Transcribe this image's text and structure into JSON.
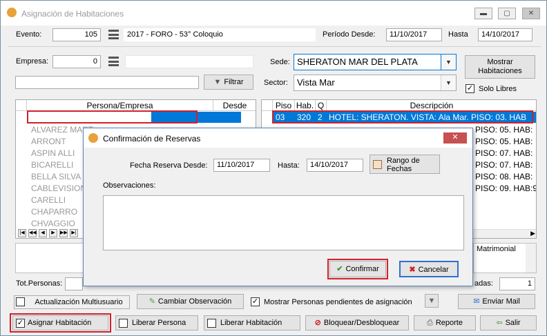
{
  "window": {
    "title": "Asignación de Habitaciones",
    "min": "▬",
    "max": "▢",
    "close": "✕"
  },
  "header": {
    "evento_label": "Evento:",
    "evento_value": "105",
    "evento_desc": "2017 - FORO - 53° Coloquio",
    "periodo_label": "Período Desde:",
    "periodo_desde": "11/10/2017",
    "hasta_label": "Hasta",
    "periodo_hasta": "14/10/2017"
  },
  "filters": {
    "empresa_label": "Empresa:",
    "empresa_value": "0",
    "filtrar_label": "Filtrar",
    "sede_label": "Sede:",
    "sede_value": "SHERATON MAR DEL PLATA",
    "sector_label": "Sector:",
    "sector_value": "Vista Mar",
    "mostrar_label": "Mostrar Habitaciones",
    "solo_libres_label": "Solo Libres"
  },
  "personas": {
    "col_persona": "Persona/Empresa",
    "col_desde": "Desde",
    "rows": [
      "ALVAREZ MART",
      "ARRONT",
      "ASPIN ALLI",
      "BICARELLI",
      "BELLA SILVA",
      "CABLEVISION",
      "CARELLI",
      "CHAPARRO",
      "CHVAGGIO"
    ]
  },
  "habitaciones": {
    "col_piso": "Piso",
    "col_hab": "Hab.",
    "col_q": "Q",
    "col_desc": "Descripción",
    "selected": {
      "piso": "03",
      "hab": "320",
      "q": "2",
      "desc": "HOTEL: SHERATON. VISTA: Ala Mar. PISO: 03. HAB"
    },
    "rows": [
      "PISO: 05. HAB:",
      "PISO: 05. HAB:",
      "PISO: 07. HAB:",
      "PISO: 07. HAB:",
      "PISO: 08. HAB:",
      "PISO: 09. HAB:9"
    ]
  },
  "bottom": {
    "matrimonial": "Matrimonial",
    "tot_personas": "Tot.Personas:",
    "adas": "adas:",
    "adas_value": "1",
    "actualizacion": "Actualización Multiusuario",
    "cambiar_obs": "Cambiar Observación",
    "mostrar_pend": "Mostrar Personas pendientes de asignación",
    "enviar_mail": "Enviar Mail"
  },
  "actions": {
    "asignar": "Asignar Habitación",
    "liberar_persona": "Liberar Persona",
    "liberar_hab": "Liberar Habitación",
    "bloquear": "Bloquear/Desbloquear",
    "reporte": "Reporte",
    "salir": "Salir"
  },
  "dialog": {
    "title": "Confirmación de Reservas",
    "close": "✕",
    "fecha_label": "Fecha Reserva Desde:",
    "fecha_desde": "11/10/2017",
    "hasta_label": "Hasta:",
    "fecha_hasta": "14/10/2017",
    "rango_label": "Rango de Fechas",
    "obs_label": "Observaciones:",
    "confirmar": "Confirmar",
    "cancelar": "Cancelar"
  }
}
